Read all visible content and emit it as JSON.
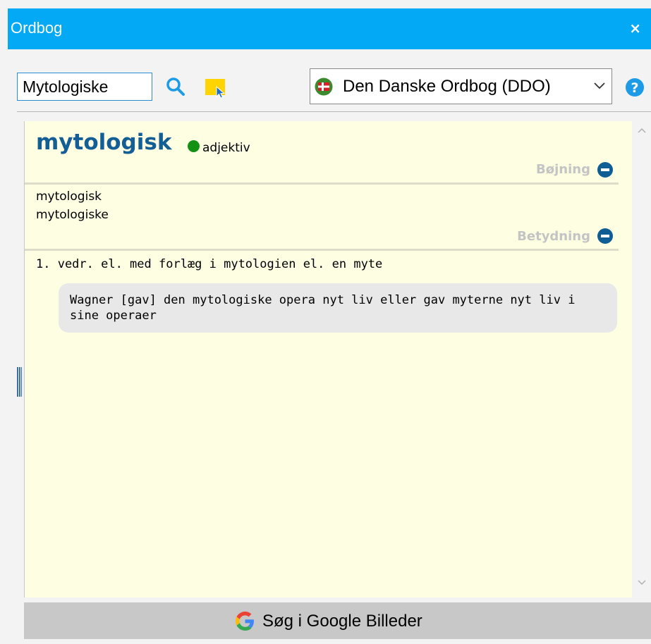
{
  "window": {
    "title": "Ordbog",
    "close_label": "×"
  },
  "toolbar": {
    "search_value": "Mytologiske",
    "dictionary_selected": "Den Danske Ordbog (DDO)"
  },
  "entry": {
    "headword": "mytologisk",
    "part_of_speech": "adjektiv",
    "inflection_header": "Bøjning",
    "forms": [
      "mytologisk",
      "mytologiske"
    ],
    "meaning_header": "Betydning",
    "senses": [
      {
        "text": "1. vedr. el. med forlæg i mytologien el. en myte",
        "example": "Wagner [gav] den mytologiske opera nyt liv eller gav myterne nyt liv i sine operaer"
      }
    ]
  },
  "footer": {
    "google_button_label": "Søg i Google Billeder"
  },
  "colors": {
    "titlebar": "#03a9f4",
    "headword": "#135e94",
    "pos_dot": "#139113",
    "content_bg": "#fefee3",
    "example_bg": "#e8e8e8"
  },
  "icons": {
    "search": "search-icon",
    "highlight": "cursor-highlight-icon",
    "flag": "danish-flag-icon",
    "help": "help-icon",
    "google": "google-logo-icon",
    "section_toggle": "minus-circle-icon"
  }
}
